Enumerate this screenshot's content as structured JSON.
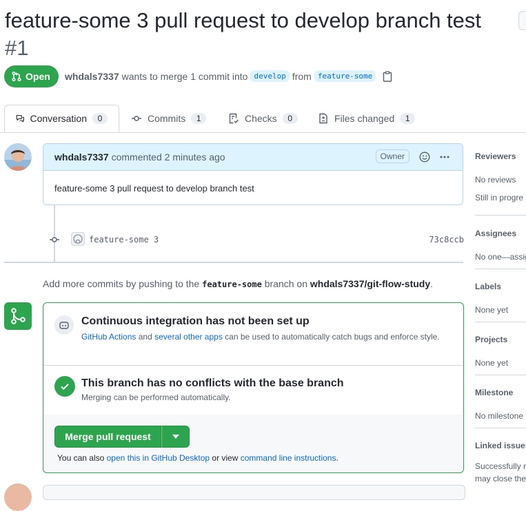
{
  "pr": {
    "title": "feature-some 3 pull request to develop branch test",
    "number": "#1",
    "state": "Open",
    "author": "whdals7337",
    "merge_text_1": "wants to merge 1 commit into",
    "base_branch": "develop",
    "from_text": "from",
    "head_branch": "feature-some"
  },
  "tabs": [
    {
      "label": "Conversation",
      "count": "0"
    },
    {
      "label": "Commits",
      "count": "1"
    },
    {
      "label": "Checks",
      "count": "0"
    },
    {
      "label": "Files changed",
      "count": "1"
    }
  ],
  "comment": {
    "author": "whdals7337",
    "action": "commented 2 minutes ago",
    "badge": "Owner",
    "body": "feature-some 3 pull request to develop branch test"
  },
  "commit": {
    "message": "feature-some 3",
    "sha": "73c8ccb"
  },
  "push_hint": {
    "prefix": "Add more commits by pushing to the",
    "branch": "feature-some",
    "middle": "branch on",
    "repo": "whdals7337/git-flow-study",
    "suffix": "."
  },
  "merge_box": {
    "ci_title": "Continuous integration has not been set up",
    "ci_link_1": "GitHub Actions",
    "ci_and": "and",
    "ci_link_2": "several other apps",
    "ci_rest": "can be used to automatically catch bugs and enforce style.",
    "conflict_title": "This branch has no conflicts with the base branch",
    "conflict_desc": "Merging can be performed automatically.",
    "merge_button": "Merge pull request",
    "alt_prefix": "You can also",
    "alt_link_1": "open this in GitHub Desktop",
    "alt_middle": "or view",
    "alt_link_2": "command line instructions",
    "alt_suffix": "."
  },
  "sidebar": {
    "reviewers": {
      "heading": "Reviewers",
      "line1": "No reviews",
      "line2": "Still in progre"
    },
    "assignees": {
      "heading": "Assignees",
      "value": "No one—assig"
    },
    "labels": {
      "heading": "Labels",
      "value": "None yet"
    },
    "projects": {
      "heading": "Projects",
      "value": "None yet"
    },
    "milestone": {
      "heading": "Milestone",
      "value": "No milestone"
    },
    "linked_issues": {
      "heading": "Linked issues",
      "line1": "Successfully m",
      "line2": "may close the"
    }
  },
  "colors": {
    "open_green": "#2da44e",
    "link_blue": "#0969da",
    "comment_header_bg": "#ddf4ff"
  }
}
